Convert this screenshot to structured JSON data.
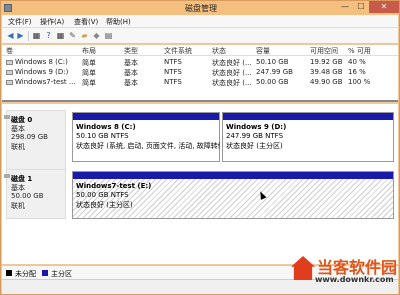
{
  "window": {
    "title": "磁盘管理",
    "minimize": "—",
    "maximize": "☐",
    "close": "✕"
  },
  "menu": [
    "文件(F)",
    "操作(A)",
    "查看(V)",
    "帮助(H)"
  ],
  "toolbar_icons": [
    "back-icon",
    "forward-icon",
    "grid-icon",
    "help-icon",
    "grid2-icon",
    "rename-icon",
    "folder-icon",
    "tag-icon",
    "properties-icon"
  ],
  "columns": [
    "卷",
    "布局",
    "类型",
    "文件系统",
    "状态",
    "容量",
    "可用空间",
    "% 可用"
  ],
  "volumes": [
    {
      "name": "Windows 8 (C:)",
      "layout": "简单",
      "type": "基本",
      "fs": "NTFS",
      "status": "状态良好 (...",
      "capacity": "50.10 GB",
      "free": "19.92 GB",
      "pct": "40 %"
    },
    {
      "name": "Windows 9 (D:)",
      "layout": "简单",
      "type": "基本",
      "fs": "NTFS",
      "status": "状态良好 (...",
      "capacity": "247.99 GB",
      "free": "39.48 GB",
      "pct": "16 %"
    },
    {
      "name": "Windows7-test ...",
      "layout": "简单",
      "type": "基本",
      "fs": "NTFS",
      "status": "状态良好 (...",
      "capacity": "50.00 GB",
      "free": "49.90 GB",
      "pct": "100 %"
    }
  ],
  "disks": [
    {
      "name": "磁盘 0",
      "type": "基本",
      "size": "298.09 GB",
      "state": "联机",
      "partitions": [
        {
          "name": "Windows 8  (C:)",
          "size": "50.10 GB NTFS",
          "status": "状态良好 (系统, 启动, 页面文件, 活动, 故障转储"
        },
        {
          "name": "Windows 9  (D:)",
          "size": "247.99 GB NTFS",
          "status": "状态良好 (主分区)"
        }
      ]
    },
    {
      "name": "磁盘 1",
      "type": "基本",
      "size": "50.00 GB",
      "state": "联机",
      "partitions": [
        {
          "name": "Windows7-test  (E:)",
          "size": "50.00 GB NTFS",
          "status": "状态良好 (主分区)"
        }
      ]
    }
  ],
  "legend": [
    {
      "label": "未分配",
      "color": "#000000"
    },
    {
      "label": "主分区",
      "color": "#1a1aaa"
    }
  ],
  "watermark": {
    "text": "当客软件园",
    "url": "www.downkr.com"
  }
}
